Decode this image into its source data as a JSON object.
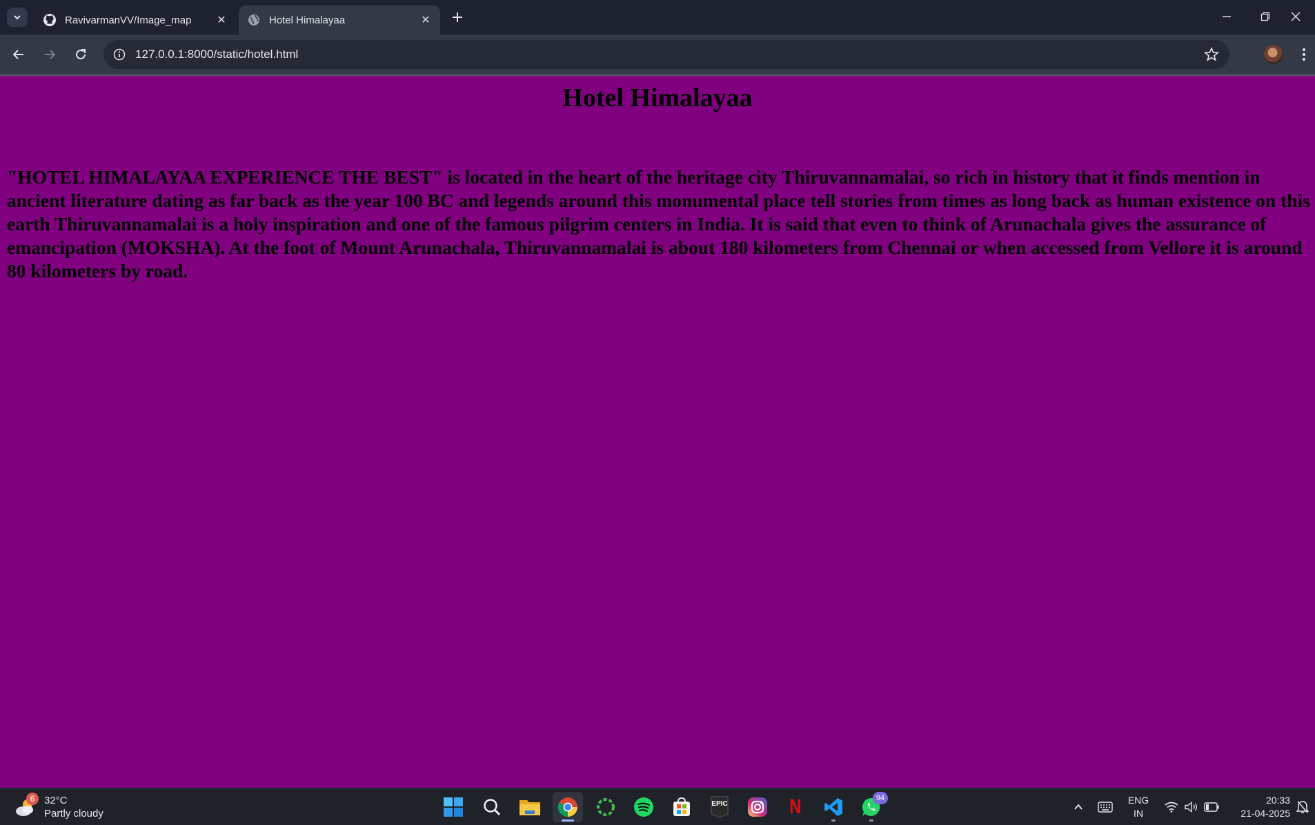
{
  "browser": {
    "tabs": [
      {
        "title": "RavivarmanVV/Image_map",
        "favicon": "github-icon",
        "active": false
      },
      {
        "title": "Hotel Himalayaa",
        "favicon": "globe-icon",
        "active": true
      }
    ],
    "url": "127.0.0.1:8000/static/hotel.html"
  },
  "page": {
    "background": "#800080",
    "heading": "Hotel Himalayaa",
    "paragraph": "\"HOTEL HIMALAYAA EXPERIENCE THE BEST\" is located in the heart of the heritage city Thiruvannamalai, so rich in history that it finds mention in ancient literature dating as far back as the year 100 BC and legends around this monumental place tell stories from times as long back as human existence on this earth Thiruvannamalai is a holy inspiration and one of the famous pilgrim centers in India. It is said that even to think of Arunachala gives the assurance of emancipation (MOKSHA). At the foot of Mount Arunachala, Thiruvannamalai is about 180 kilometers from Chennai or when accessed from Vellore it is around 80 kilometers by road."
  },
  "taskbar": {
    "weather": {
      "temp": "32°C",
      "condition": "Partly cloudy",
      "badge": "6"
    },
    "apps": [
      {
        "name": "start-icon"
      },
      {
        "name": "search-icon"
      },
      {
        "name": "file-explorer-icon"
      },
      {
        "name": "chrome-icon",
        "active": true
      },
      {
        "name": "circular-app-icon"
      },
      {
        "name": "spotify-icon"
      },
      {
        "name": "microsoft-store-icon"
      },
      {
        "name": "epic-games-icon",
        "label": "EPIC"
      },
      {
        "name": "instagram-icon"
      },
      {
        "name": "netflix-icon",
        "label": "N"
      },
      {
        "name": "vscode-icon"
      },
      {
        "name": "whatsapp-icon",
        "badge": "94"
      }
    ],
    "lang": {
      "line1": "ENG",
      "line2": "IN"
    },
    "clock": {
      "time": "20:33",
      "date": "21-04-2025"
    }
  }
}
